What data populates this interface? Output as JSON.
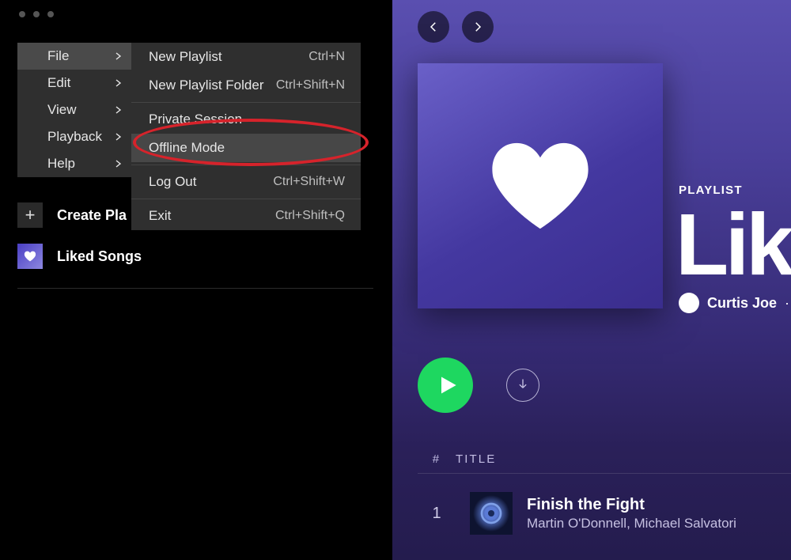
{
  "left": {
    "create_label": "Create Pla",
    "liked_label": "Liked Songs"
  },
  "menu_main": [
    {
      "label": "File",
      "active": true
    },
    {
      "label": "Edit"
    },
    {
      "label": "View"
    },
    {
      "label": "Playback"
    },
    {
      "label": "Help"
    }
  ],
  "menu_sub": [
    {
      "label": "New Playlist",
      "shortcut": "Ctrl+N"
    },
    {
      "label": "New Playlist Folder",
      "shortcut": "Ctrl+Shift+N"
    },
    {
      "divider": true
    },
    {
      "label": "Private Session",
      "shortcut": ""
    },
    {
      "label": "Offline Mode",
      "shortcut": "",
      "hover": true
    },
    {
      "divider": true
    },
    {
      "label": "Log Out",
      "shortcut": "Ctrl+Shift+W"
    },
    {
      "divider": true
    },
    {
      "label": "Exit",
      "shortcut": "Ctrl+Shift+Q"
    }
  ],
  "playlist": {
    "eyebrow": "PLAYLIST",
    "title": "Like",
    "owner": "Curtis Joe",
    "sep": "·",
    "header_hash": "#",
    "header_title": "TITLE",
    "tracks": [
      {
        "num": "1",
        "title": "Finish the Fight",
        "artists": "Martin O'Donnell, Michael Salvatori"
      }
    ]
  }
}
